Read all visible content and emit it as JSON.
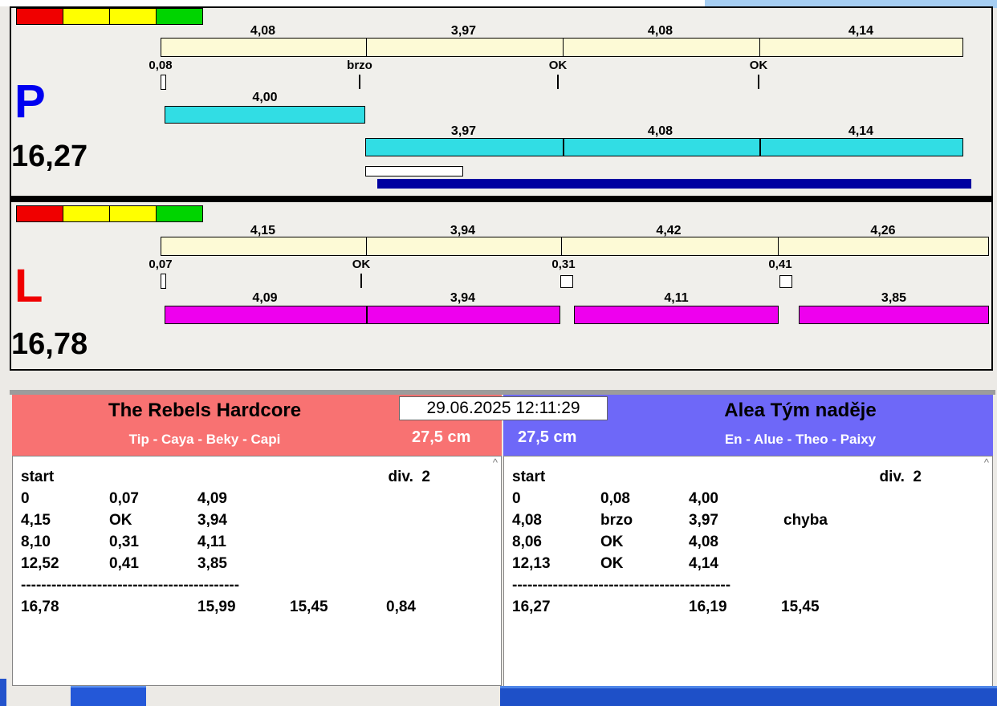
{
  "datetime": "29.06.2025 12:11:29",
  "icons": {
    "scroll_up_glyph": "^"
  },
  "colors": {
    "cyan_bar": "#31dde4",
    "magenta_bar": "#ee00ee",
    "target_bar": "#fdfad6",
    "navy_bar": "#0000a0",
    "team_left_header": "#f87272",
    "team_right_header": "#6e68f8",
    "light_red": "#f00000",
    "light_yellow": "#ffff00",
    "light_green": "#00d400",
    "lane_p_letter": "#0000f0",
    "lane_l_letter": "#f00000"
  },
  "lane_p": {
    "label": "P",
    "total": "16,27",
    "split_labels": [
      "4,08",
      "3,97",
      "4,08",
      "4,14"
    ],
    "marks": [
      "0,08",
      "brzo",
      "OK",
      "OK"
    ],
    "first_run_label": "4,00",
    "run_labels": [
      "3,97",
      "4,08",
      "4,14"
    ]
  },
  "lane_l": {
    "label": "L",
    "total": "16,78",
    "split_labels": [
      "4,15",
      "3,94",
      "4,42",
      "4,26"
    ],
    "marks": [
      "0,07",
      "OK",
      "0,31",
      "0,41"
    ],
    "run_labels": [
      "4,09",
      "3,94",
      "4,11",
      "3,85"
    ]
  },
  "team_left": {
    "name": "The Rebels Hardcore",
    "members": "Tip - Caya - Beky - Capi",
    "height": "27,5 cm",
    "start_label": "start",
    "division": "div.  2",
    "rows": [
      [
        "0",
        "0,07",
        "4,09",
        ""
      ],
      [
        "4,15",
        "OK",
        "3,94",
        ""
      ],
      [
        "8,10",
        "0,31",
        "4,11",
        ""
      ],
      [
        "12,52",
        "0,41",
        "3,85",
        ""
      ]
    ],
    "separator": "-------------------------------------------",
    "totals": [
      "16,78",
      "15,99",
      "15,45",
      "0,84"
    ]
  },
  "team_right": {
    "name": "Alea Tým naděje",
    "members": "En - Alue - Theo - Paixy",
    "height": "27,5 cm",
    "start_label": "start",
    "division": "div.  2",
    "rows": [
      [
        "0",
        "0,08",
        "4,00",
        ""
      ],
      [
        "4,08",
        "brzo",
        "3,97",
        "chyba"
      ],
      [
        "8,06",
        "OK",
        "4,08",
        ""
      ],
      [
        "12,13",
        "OK",
        "4,14",
        ""
      ]
    ],
    "separator": "-------------------------------------------",
    "totals": [
      "16,27",
      "16,19",
      "15,45",
      ""
    ]
  }
}
